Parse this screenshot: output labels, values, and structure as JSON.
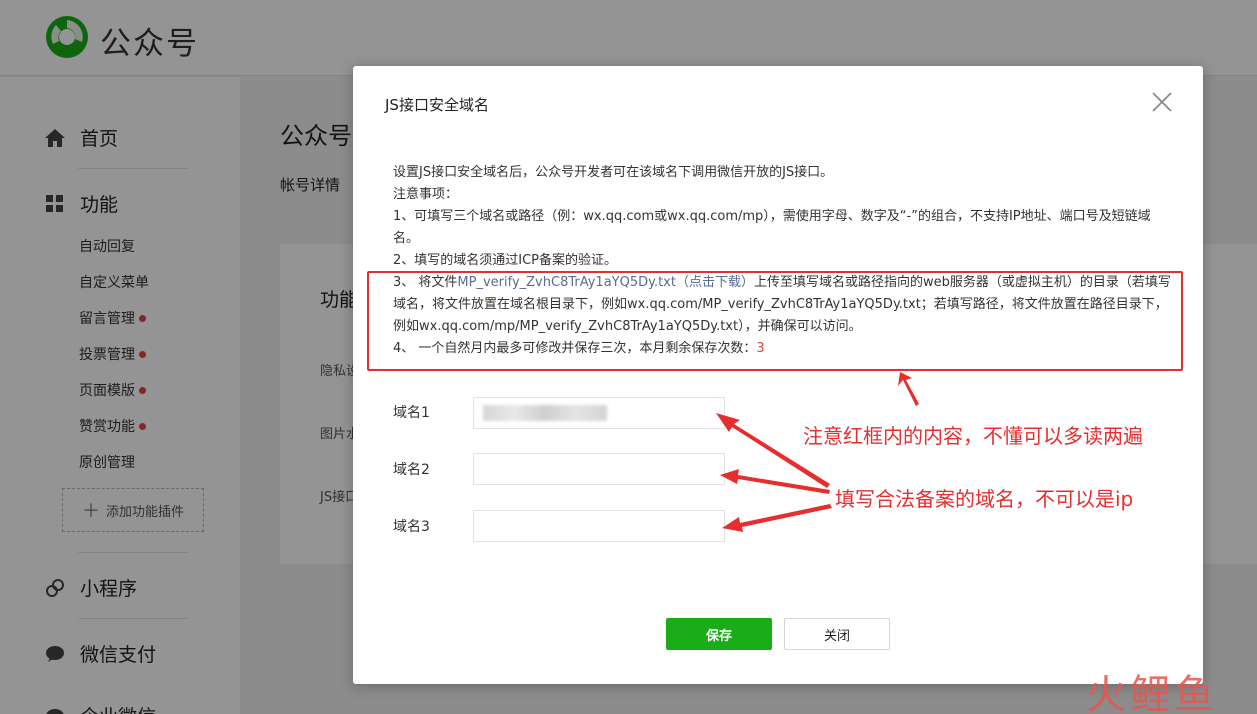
{
  "header": {
    "brand": "公众号"
  },
  "sidebar": {
    "home": "首页",
    "features": "功能",
    "sub_items": [
      {
        "label": "自动回复",
        "dot": false
      },
      {
        "label": "自定义菜单",
        "dot": false
      },
      {
        "label": "留言管理",
        "dot": true
      },
      {
        "label": "投票管理",
        "dot": true
      },
      {
        "label": "页面模版",
        "dot": true
      },
      {
        "label": "赞赏功能",
        "dot": true
      },
      {
        "label": "原创管理",
        "dot": false
      }
    ],
    "add_plugin": "添加功能插件",
    "mini_program": "小程序",
    "wechat_pay": "微信支付",
    "enterprise": "企业微信"
  },
  "main": {
    "title": "公众号",
    "tab": "帐号详情",
    "panel_title": "功能",
    "rows": [
      "隐私设",
      "图片水",
      "JS接口"
    ]
  },
  "dialog": {
    "title": "JS接口安全域名",
    "intro": "设置JS接口安全域名后，公众号开发者可在该域名下调用微信开放的JS接口。",
    "notes_heading": "注意事项：",
    "note1": "1、可填写三个域名或路径（例：wx.qq.com或wx.qq.com/mp），需使用字母、数字及“-”的组合，不支持IP地址、端口号及短链域名。",
    "note2": "2、填写的域名须通过ICP备案的验证。",
    "note3_prefix": "3、 将文件",
    "note3_file": "MP_verify_ZvhC8TrAy1aYQ5Dy.txt",
    "note3_download": "（点击下载）",
    "note3_rest": "上传至填写域名或路径指向的web服务器（或虚拟主机）的目录（若填写域名，将文件放置在域名根目录下，例如wx.qq.com/MP_verify_ZvhC8TrAy1aYQ5Dy.txt；若填写路径，将文件放置在路径目录下，例如wx.qq.com/mp/MP_verify_ZvhC8TrAy1aYQ5Dy.txt），并确保可以访问。",
    "note4_prefix": "4、 一个自然月内最多可修改并保存三次，本月剩余保存次数：",
    "note4_count": "3",
    "fields": [
      {
        "label": "域名1",
        "value": ""
      },
      {
        "label": "域名2",
        "value": ""
      },
      {
        "label": "域名3",
        "value": ""
      }
    ],
    "save_label": "保存",
    "close_label": "关闭"
  },
  "annotations": {
    "note_box": "注意红框内的内容，不懂可以多读两遍",
    "domains": "填写合法备案的域名，不可以是ip"
  },
  "watermark": "火鲤鱼",
  "colors": {
    "brand_green": "#1aad19",
    "annotation_red": "#e62e2e",
    "link_blue": "#576b95",
    "dot_red": "#e64340"
  }
}
